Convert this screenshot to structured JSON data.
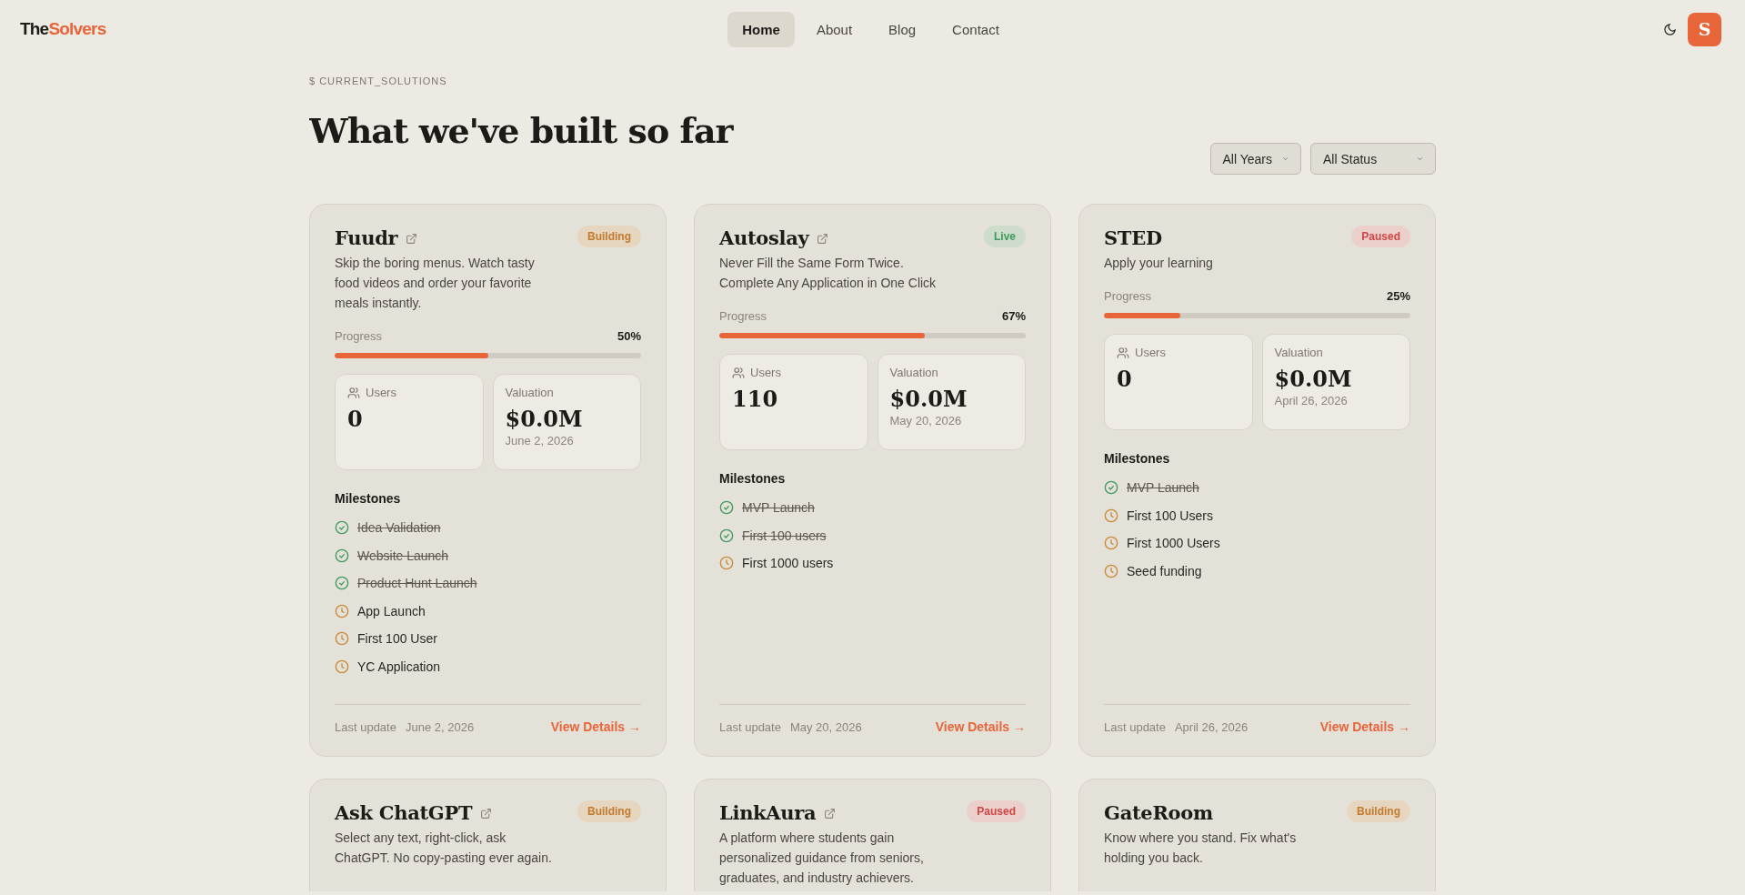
{
  "header": {
    "logo": {
      "prefix": "The",
      "accent": "Solvers"
    },
    "nav": [
      {
        "label": "Home",
        "selected": true
      },
      {
        "label": "About",
        "selected": false
      },
      {
        "label": "Blog",
        "selected": false
      },
      {
        "label": "Contact",
        "selected": false
      }
    ],
    "avatar": "S"
  },
  "section": {
    "eyebrow": "$ CURRENT_SOLUTIONS",
    "title": "What we've built so far",
    "filters": [
      "All Years",
      "All Status"
    ],
    "projects": [
      {
        "name": "Fuudr",
        "external_link": true,
        "status": {
          "label": "Building",
          "kind": "building"
        },
        "description": "Skip the boring menus. Watch tasty food videos and order your favorite meals instantly.",
        "progress_label": "Progress",
        "progress_text": "50%",
        "level": 0.5,
        "users_label": "Users",
        "users": "0",
        "valuation_label": "Valuation",
        "valuation": "$0.0M",
        "valuation_date": "June 2, 2026",
        "milestones_label": "Milestones",
        "milestones": [
          {
            "label": "Idea Validation",
            "done": true
          },
          {
            "label": "Website Launch",
            "done": true
          },
          {
            "label": "Product Hunt Launch",
            "done": true
          },
          {
            "label": "App Launch",
            "done": false
          },
          {
            "label": "First 100 User",
            "done": false
          },
          {
            "label": "YC Application",
            "done": false
          }
        ],
        "last_update_label": "Last update",
        "last_update": "June 2, 2026",
        "details_link": "View Details →"
      },
      {
        "name": "Autoslay",
        "external_link": true,
        "status": {
          "label": "Live",
          "kind": "live"
        },
        "description": "Never Fill the Same Form Twice.\nComplete Any Application in One Click",
        "progress_label": "Progress",
        "progress_text": "67%",
        "level": 0.67,
        "users_label": "Users",
        "users": "110",
        "valuation_label": "Valuation",
        "valuation": "$0.0M",
        "valuation_date": "May 20, 2026",
        "milestones_label": "Milestones",
        "milestones": [
          {
            "label": "MVP Launch",
            "done": true
          },
          {
            "label": "First 100 users",
            "done": true
          },
          {
            "label": "First 1000 users",
            "done": false
          }
        ],
        "last_update_label": "Last update",
        "last_update": "May 20, 2026",
        "details_link": "View Details →"
      },
      {
        "name": "STED",
        "external_link": false,
        "status": {
          "label": "Paused",
          "kind": "paused"
        },
        "description": "Apply your learning",
        "progress_label": "Progress",
        "progress_text": "25%",
        "level": 0.25,
        "users_label": "Users",
        "users": "0",
        "valuation_label": "Valuation",
        "valuation": "$0.0M",
        "valuation_date": "April 26, 2026",
        "milestones_label": "Milestones",
        "milestones": [
          {
            "label": "MVP Launch",
            "done": true
          },
          {
            "label": "First 100 Users",
            "done": false
          },
          {
            "label": "First 1000 Users",
            "done": false
          },
          {
            "label": "Seed funding",
            "done": false
          }
        ],
        "last_update_label": "Last update",
        "last_update": "April 26, 2026",
        "details_link": "View Details →"
      },
      {
        "name": "Ask ChatGPT",
        "external_link": true,
        "status": {
          "label": "Building",
          "kind": "building"
        },
        "description": "Select any text, right-click, ask ChatGPT. No copy-pasting ever again."
      },
      {
        "name": "LinkAura",
        "external_link": true,
        "status": {
          "label": "Paused",
          "kind": "paused"
        },
        "description": "A platform where students gain personalized guidance from seniors, graduates, and industry achievers."
      },
      {
        "name": "GateRoom",
        "external_link": false,
        "status": {
          "label": "Building",
          "kind": "building"
        },
        "description": "Know where you stand. Fix what's holding you back."
      }
    ]
  }
}
